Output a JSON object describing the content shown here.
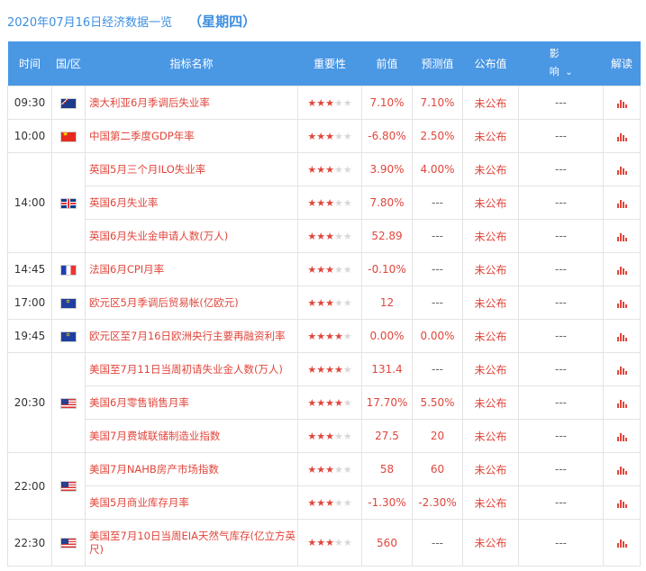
{
  "header": {
    "date": "2020年07月16日经济数据一览",
    "weekday": "（星期四）"
  },
  "columns": {
    "time": "时间",
    "country": "国/区",
    "indicator": "指标名称",
    "importance": "重要性",
    "previous": "前值",
    "forecast": "预测值",
    "actual": "公布值",
    "impact": "影响",
    "interpret": "解读"
  },
  "impact_chevron": "chevron-down-icon",
  "colors": {
    "header_bg": "#4a97e4",
    "accent_red": "#e0463c",
    "title_blue": "#3d8fe0"
  },
  "rows": [
    {
      "time": "09:30",
      "flag": "australia-flag-icon",
      "name": "澳大利亚6月季调后失业率",
      "stars": 3,
      "previous": "7.10%",
      "forecast": "7.10%",
      "actual": "未公布",
      "impact": "---"
    },
    {
      "time": "10:00",
      "flag": "china-flag-icon",
      "name": "中国第二季度GDP年率",
      "stars": 3,
      "previous": "-6.80%",
      "forecast": "2.50%",
      "actual": "未公布",
      "impact": "---"
    },
    {
      "time": "14:00",
      "flag": "uk-flag-icon",
      "name": "英国5月三个月ILO失业率",
      "stars": 3,
      "previous": "3.90%",
      "forecast": "4.00%",
      "actual": "未公布",
      "impact": "---"
    },
    {
      "time": "",
      "flag": "",
      "name": "英国6月失业率",
      "stars": 3,
      "previous": "7.80%",
      "forecast": "---",
      "actual": "未公布",
      "impact": "---"
    },
    {
      "time": "",
      "flag": "",
      "name": "英国6月失业金申请人数(万人)",
      "stars": 3,
      "previous": "52.89",
      "forecast": "---",
      "actual": "未公布",
      "impact": "---"
    },
    {
      "time": "14:45",
      "flag": "france-flag-icon",
      "name": "法国6月CPI月率",
      "stars": 3,
      "previous": "-0.10%",
      "forecast": "---",
      "actual": "未公布",
      "impact": "---"
    },
    {
      "time": "17:00",
      "flag": "eu-flag-icon",
      "name": "欧元区5月季调后贸易帐(亿欧元)",
      "stars": 3,
      "previous": "12",
      "forecast": "---",
      "actual": "未公布",
      "impact": "---"
    },
    {
      "time": "19:45",
      "flag": "eu-flag-icon",
      "name": "欧元区至7月16日欧洲央行主要再融资利率",
      "stars": 4,
      "previous": "0.00%",
      "forecast": "0.00%",
      "actual": "未公布",
      "impact": "---"
    },
    {
      "time": "20:30",
      "flag": "us-flag-icon",
      "name": "美国至7月11日当周初请失业金人数(万人)",
      "stars": 4,
      "previous": "131.4",
      "forecast": "---",
      "actual": "未公布",
      "impact": "---"
    },
    {
      "time": "",
      "flag": "",
      "name": "美国6月零售销售月率",
      "stars": 4,
      "previous": "17.70%",
      "forecast": "5.50%",
      "actual": "未公布",
      "impact": "---"
    },
    {
      "time": "",
      "flag": "",
      "name": "美国7月费城联储制造业指数",
      "stars": 3,
      "previous": "27.5",
      "forecast": "20",
      "actual": "未公布",
      "impact": "---"
    },
    {
      "time": "22:00",
      "flag": "us-flag-icon",
      "name": "美国7月NAHB房产市场指数",
      "stars": 3,
      "previous": "58",
      "forecast": "60",
      "actual": "未公布",
      "impact": "---"
    },
    {
      "time": "",
      "flag": "",
      "name": "美国5月商业库存月率",
      "stars": 3,
      "previous": "-1.30%",
      "forecast": "-2.30%",
      "actual": "未公布",
      "impact": "---"
    },
    {
      "time": "22:30",
      "flag": "us-flag-icon",
      "name": "美国至7月10日当周EIA天然气库存(亿立方英尺)",
      "stars": 3,
      "previous": "560",
      "forecast": "---",
      "actual": "未公布",
      "impact": "---"
    }
  ]
}
